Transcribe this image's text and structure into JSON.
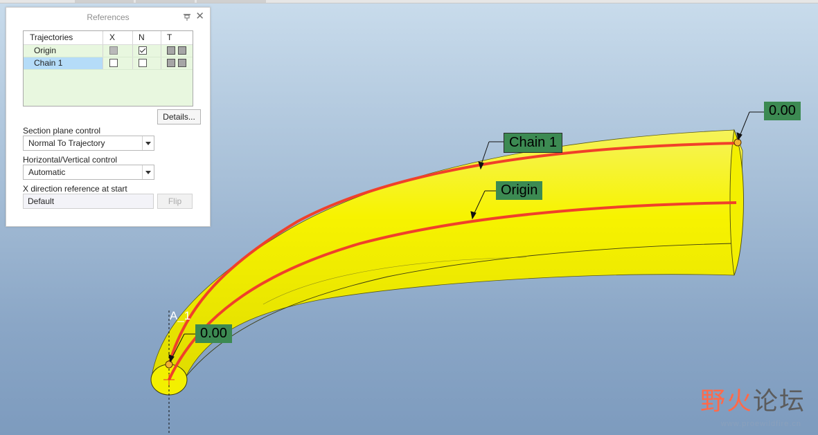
{
  "panel": {
    "title": "References",
    "table": {
      "headers": [
        "Trajectories",
        "X",
        "N",
        "T"
      ],
      "rows": [
        {
          "name": "Origin",
          "x": "gray",
          "n": "checked",
          "selected": false
        },
        {
          "name": "Chain 1",
          "x": "unchecked",
          "n": "unchecked",
          "selected": true
        }
      ]
    },
    "details_button": "Details...",
    "section_plane_label": "Section plane control",
    "section_plane_value": "Normal To Trajectory",
    "hv_label": "Horizontal/Vertical control",
    "hv_value": "Automatic",
    "xdir_label": "X direction reference at start",
    "xdir_value": "Default",
    "flip_button": "Flip"
  },
  "viewport": {
    "callout_chain1": "Chain 1",
    "callout_origin": "Origin",
    "dim_end": "0.00",
    "dim_start": "0.00",
    "axis_label": "A_1"
  },
  "watermark": {
    "part1": "野火",
    "part2": "论坛",
    "url": "www.proewildfire.cn"
  },
  "colors": {
    "sweep_yellow": "#f4f300",
    "trajectory_red": "#f0402a",
    "callout_green": "#3c8a52",
    "selected_row": "#b5dcf8"
  }
}
